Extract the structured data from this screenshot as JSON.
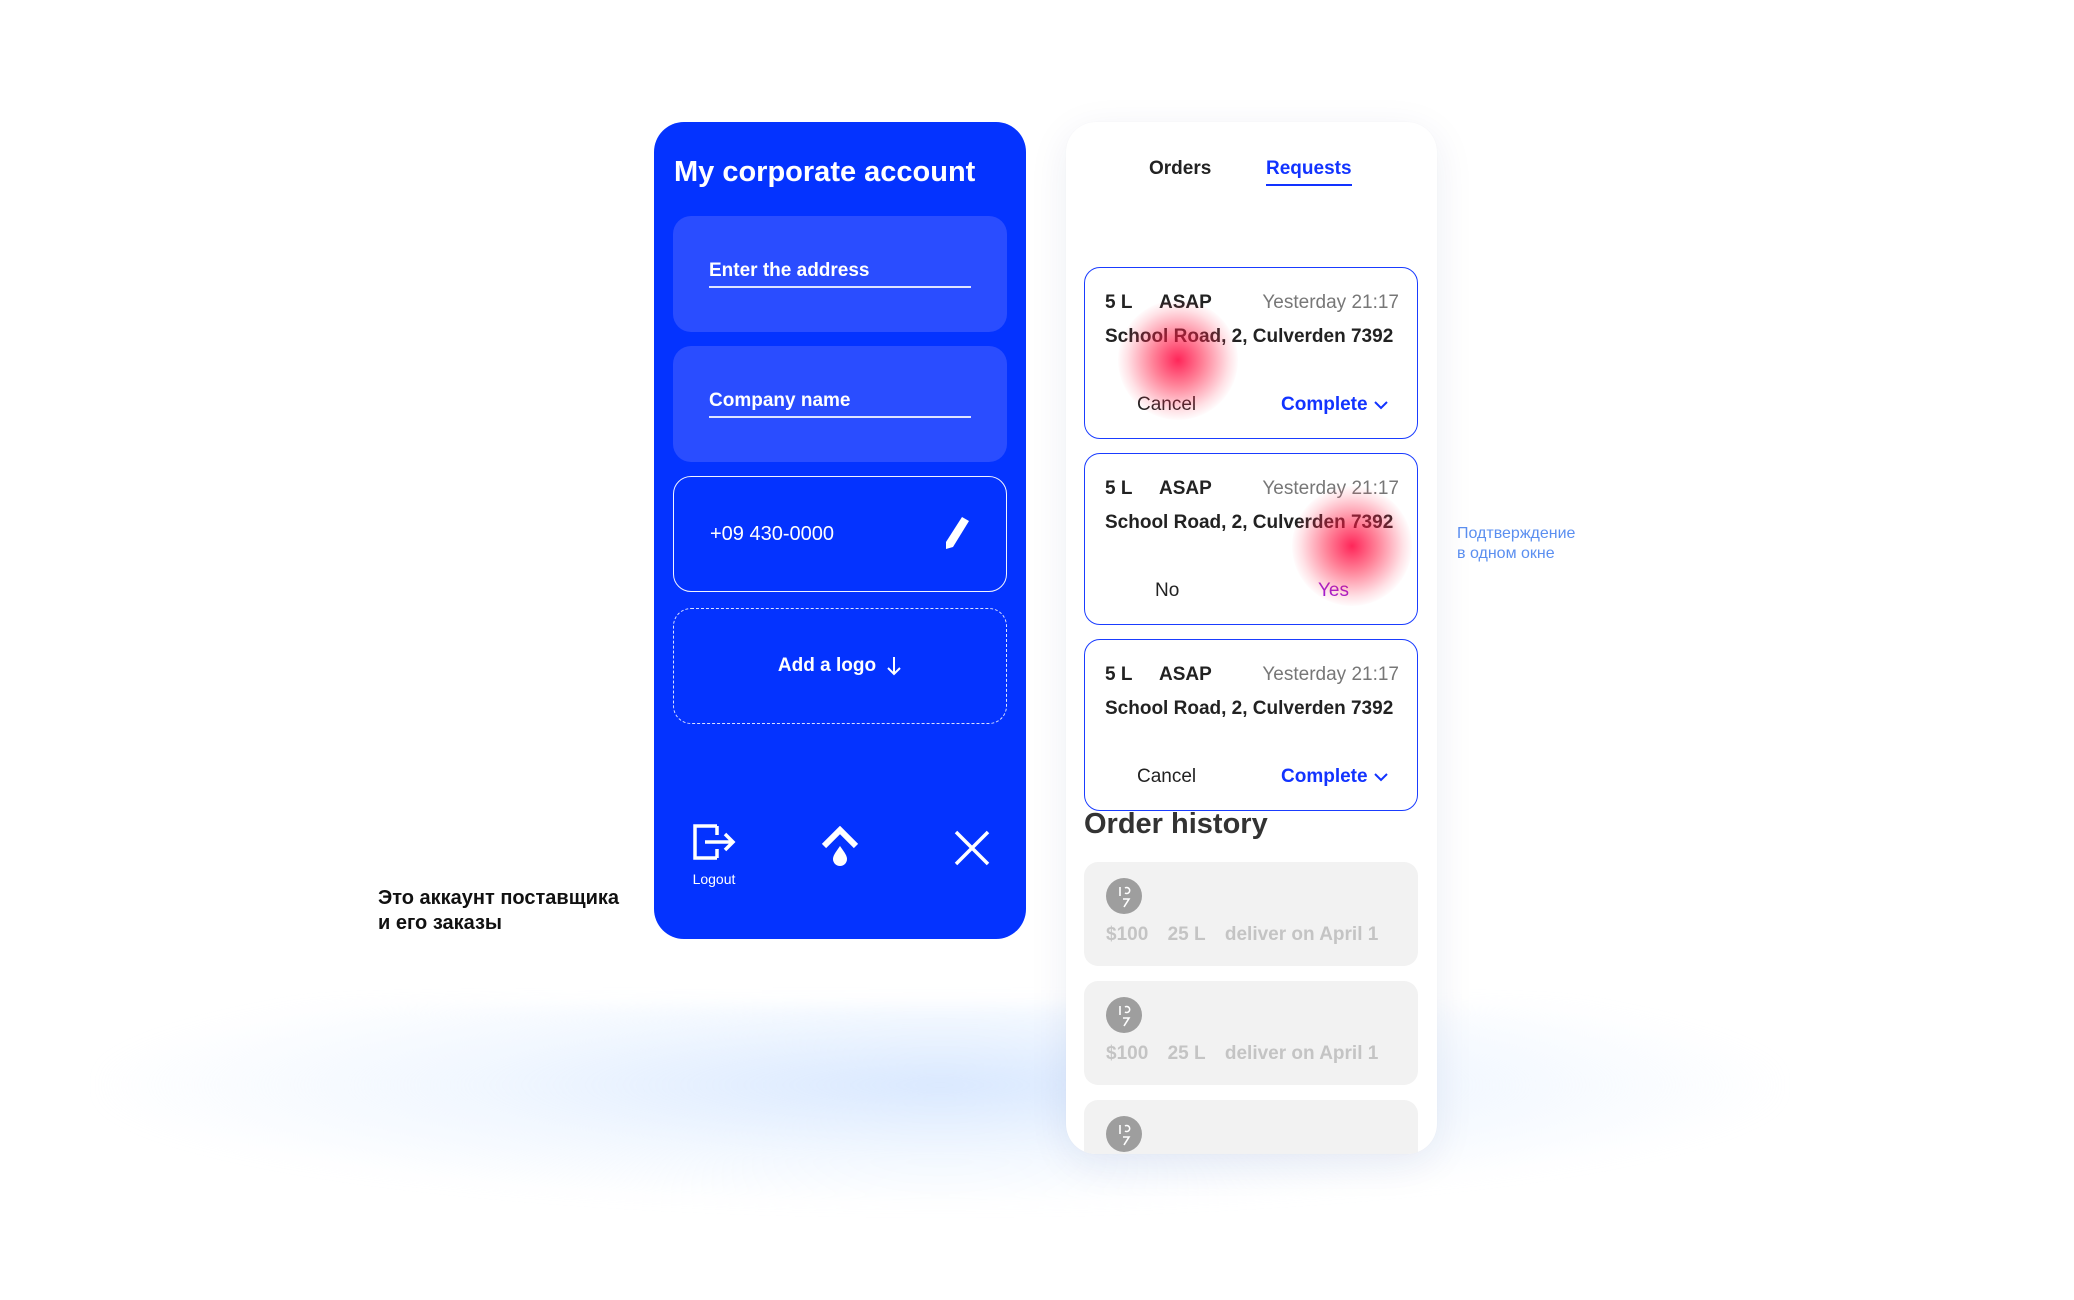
{
  "annotations": {
    "left_note": [
      "Это аккаунт поставщика",
      "и его заказы"
    ],
    "right_note": [
      "Подтверждение",
      "в одном окне"
    ]
  },
  "account": {
    "title": "My corporate account",
    "address_label": "Enter the address",
    "company_label": "Company name",
    "phone": "+09 430-0000",
    "add_logo_label": "Add a logo",
    "logout_label": "Logout"
  },
  "requests": {
    "tabs": [
      {
        "label": "Orders",
        "active": false
      },
      {
        "label": "Requests",
        "active": true
      }
    ],
    "cards": [
      {
        "volume": "5 L",
        "urgency": "ASAP",
        "time": "Yesterday 21:17",
        "address": "School Road, 2, Culverden 7392",
        "left_action": "Cancel",
        "right_action": "Complete"
      },
      {
        "volume": "5 L",
        "urgency": "ASAP",
        "time": "Yesterday 21:17",
        "address": "School Road, 2, Culverden 7392",
        "left_action": "No",
        "right_action": "Yes"
      },
      {
        "volume": "5 L",
        "urgency": "ASAP",
        "time": "Yesterday 21:17",
        "address": "School Road, 2, Culverden 7392",
        "left_action": "Cancel",
        "right_action": "Complete"
      }
    ],
    "history_title": "Order history",
    "history": [
      {
        "price": "$100",
        "volume": "25 L",
        "delivery": "deliver on April 1"
      },
      {
        "price": "$100",
        "volume": "25 L",
        "delivery": "deliver on April 1"
      }
    ]
  },
  "colors": {
    "brand_blue": "#0433ff",
    "link_blue": "#1233ff",
    "heat_red": "#ff003c"
  }
}
